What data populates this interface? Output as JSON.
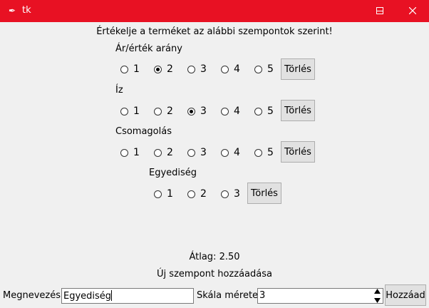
{
  "window": {
    "title": "tk",
    "icon": "feather-icon"
  },
  "heading": "Értékelje a terméket az alábbi szempontok szerint!",
  "criteria": [
    {
      "name": "Ár/érték arány",
      "options": [
        "1",
        "2",
        "3",
        "4",
        "5"
      ],
      "selected": 2,
      "clear": "Törlés"
    },
    {
      "name": "Íz",
      "options": [
        "1",
        "2",
        "3",
        "4",
        "5"
      ],
      "selected": 3,
      "clear": "Törlés"
    },
    {
      "name": "Csomagolás",
      "options": [
        "1",
        "2",
        "3",
        "4",
        "5"
      ],
      "selected": null,
      "clear": "Törlés"
    },
    {
      "name": "Egyediség",
      "options": [
        "1",
        "2",
        "3"
      ],
      "selected": null,
      "clear": "Törlés"
    }
  ],
  "average": "Átlag: 2.50",
  "add_section_title": "Új szempont hozzáadása",
  "form": {
    "name_label": "Megnevezés:",
    "name_value": "Egyediség",
    "scale_label": "Skála mérete:",
    "scale_value": "3",
    "add_button": "Hozzáad"
  }
}
